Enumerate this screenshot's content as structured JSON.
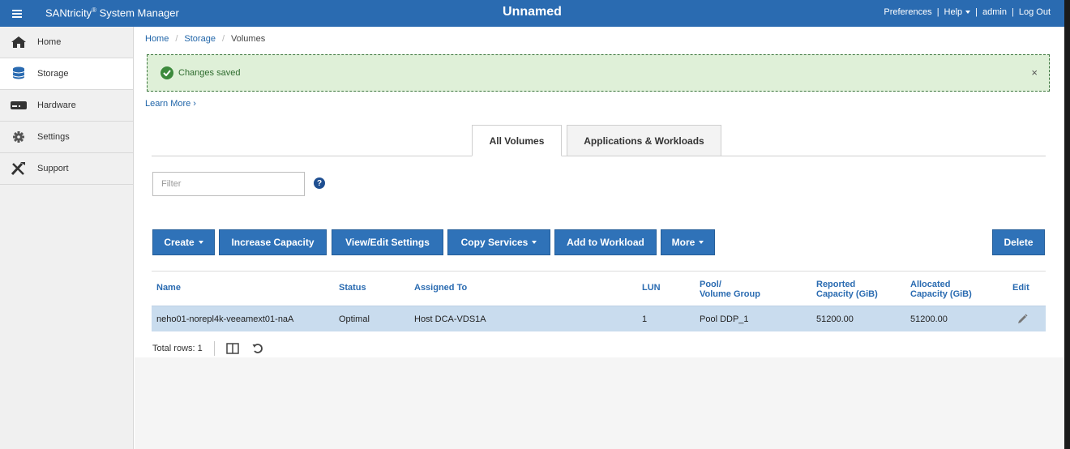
{
  "header": {
    "app_title": "SANtricity",
    "app_title_reg": "®",
    "app_title_rest": " System Manager",
    "system_name": "Unnamed",
    "links": {
      "preferences": "Preferences",
      "help": "Help",
      "user": "admin",
      "logout": "Log Out",
      "separator": "|"
    }
  },
  "sidebar": {
    "items": [
      {
        "label": "Home",
        "icon": "home-icon",
        "active": false
      },
      {
        "label": "Storage",
        "icon": "database-icon",
        "active": true
      },
      {
        "label": "Hardware",
        "icon": "hardware-icon",
        "active": false
      },
      {
        "label": "Settings",
        "icon": "gear-icon",
        "active": false
      },
      {
        "label": "Support",
        "icon": "tools-icon",
        "active": false
      }
    ]
  },
  "breadcrumb": {
    "home": "Home",
    "storage": "Storage",
    "current": "Volumes",
    "separator": "/"
  },
  "alert": {
    "message": "Changes saved",
    "close": "×",
    "color": "#dff0d8"
  },
  "learn_more": "Learn More ›",
  "tabs": {
    "all_volumes": "All Volumes",
    "applications": "Applications & Workloads"
  },
  "filter": {
    "placeholder": "Filter",
    "value": ""
  },
  "help_icon": "?",
  "toolbar": {
    "create": "Create",
    "increase_capacity": "Increase Capacity",
    "view_edit_settings": "View/Edit Settings",
    "copy_services": "Copy Services",
    "add_to_workload": "Add to Workload",
    "more": "More",
    "delete": "Delete",
    "accent_color": "#2f72b8"
  },
  "table": {
    "headers": {
      "name": "Name",
      "status": "Status",
      "assigned_to": "Assigned To",
      "lun": "LUN",
      "pool_line1": "Pool/",
      "pool_line2": "Volume Group",
      "reported_line1": "Reported",
      "reported_line2": "Capacity (GiB)",
      "allocated_line1": "Allocated",
      "allocated_line2": "Capacity (GiB)",
      "edit": "Edit"
    },
    "rows": [
      {
        "name": "neho01-norepl4k-veeamext01-naA",
        "status": "Optimal",
        "assigned_to": "Host DCA-VDS1A",
        "lun": "1",
        "pool": "Pool DDP_1",
        "reported": "51200.00",
        "allocated": "51200.00"
      }
    ],
    "total_rows": "Total rows: 1"
  }
}
